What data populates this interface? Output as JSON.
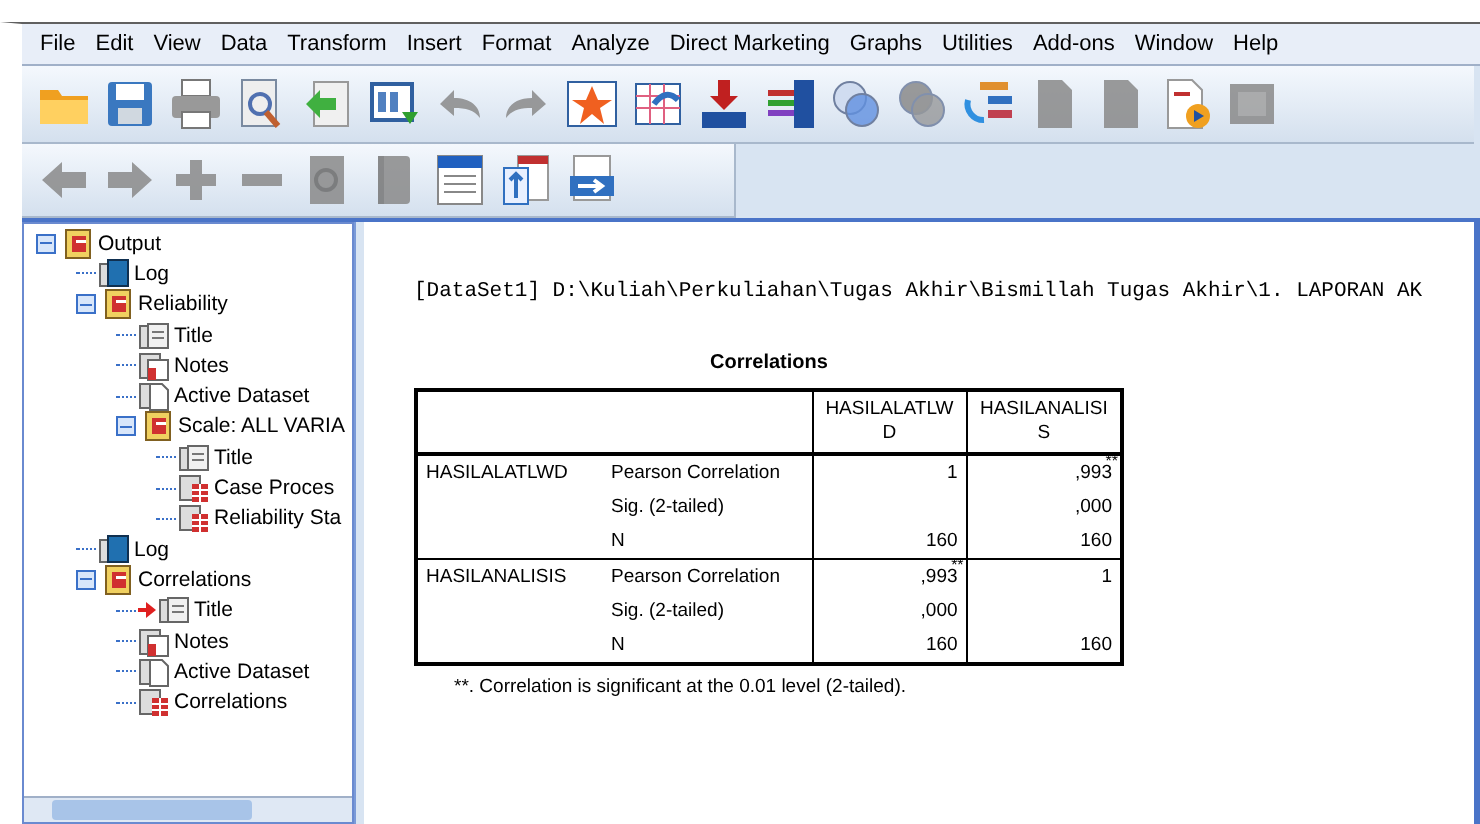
{
  "menu": [
    "File",
    "Edit",
    "View",
    "Data",
    "Transform",
    "Insert",
    "Format",
    "Analyze",
    "Direct Marketing",
    "Graphs",
    "Utilities",
    "Add-ons",
    "Window",
    "Help"
  ],
  "toolbar_main": [
    {
      "kind": "folder",
      "disabled": false
    },
    {
      "kind": "save",
      "disabled": false
    },
    {
      "kind": "print",
      "disabled": false
    },
    {
      "kind": "preview",
      "disabled": false
    },
    {
      "kind": "recall",
      "disabled": false
    },
    {
      "kind": "export",
      "disabled": false
    },
    {
      "kind": "undo",
      "disabled": true
    },
    {
      "kind": "redo",
      "disabled": true
    },
    {
      "kind": "star",
      "disabled": false
    },
    {
      "kind": "grid",
      "disabled": false
    },
    {
      "kind": "insert",
      "disabled": false
    },
    {
      "kind": "variables",
      "disabled": false
    },
    {
      "kind": "circles",
      "disabled": false
    },
    {
      "kind": "circles",
      "disabled": true
    },
    {
      "kind": "tree",
      "disabled": false
    },
    {
      "kind": "document",
      "disabled": true
    },
    {
      "kind": "document",
      "disabled": true
    },
    {
      "kind": "play",
      "disabled": false
    },
    {
      "kind": "square",
      "disabled": true
    }
  ],
  "toolbar_outline": [
    {
      "kind": "back",
      "disabled": true
    },
    {
      "kind": "forward",
      "disabled": true
    },
    {
      "kind": "plus",
      "disabled": true
    },
    {
      "kind": "minus",
      "disabled": true
    },
    {
      "kind": "preview",
      "disabled": true
    },
    {
      "kind": "book",
      "disabled": true
    },
    {
      "kind": "list",
      "disabled": false
    },
    {
      "kind": "swap",
      "disabled": false
    },
    {
      "kind": "export",
      "disabled": false
    }
  ],
  "outline": [
    {
      "label": "Output",
      "kind": "output",
      "expanded": true,
      "current": false,
      "children": [
        {
          "label": "Log",
          "kind": "log",
          "current": false
        },
        {
          "label": "Reliability",
          "kind": "output",
          "expanded": true,
          "current": false,
          "children": [
            {
              "label": "Title",
              "kind": "title",
              "current": false
            },
            {
              "label": "Notes",
              "kind": "notes",
              "current": false
            },
            {
              "label": "Active Dataset",
              "kind": "dataset",
              "current": false
            },
            {
              "label": "Scale: ALL VARIA",
              "kind": "output",
              "expanded": true,
              "current": false,
              "children": [
                {
                  "label": "Title",
                  "kind": "title",
                  "current": false
                },
                {
                  "label": "Case Proces",
                  "kind": "table",
                  "current": false
                },
                {
                  "label": "Reliability Sta",
                  "kind": "table",
                  "current": false
                }
              ]
            }
          ]
        },
        {
          "label": "Log",
          "kind": "log",
          "current": false
        },
        {
          "label": "Correlations",
          "kind": "output",
          "expanded": true,
          "current": false,
          "children": [
            {
              "label": "Title",
              "kind": "title",
              "current": true
            },
            {
              "label": "Notes",
              "kind": "notes",
              "current": false
            },
            {
              "label": "Active Dataset",
              "kind": "dataset",
              "current": false
            },
            {
              "label": "Correlations",
              "kind": "table",
              "current": false
            }
          ]
        }
      ]
    }
  ],
  "output": {
    "dataset_line": "[DataSet1] D:\\Kuliah\\Perkuliahan\\Tugas Akhir\\Bismillah Tugas Akhir\\1. LAPORAN AK",
    "table": {
      "title": "Correlations",
      "columns": [
        "HASILALATLWD",
        "HASILANALISIS"
      ],
      "groups": [
        {
          "variable": "HASILALATLWD",
          "rows": [
            {
              "statistic": "Pearson Correlation",
              "cells": [
                {
                  "text": "1"
                },
                {
                  "text": ",993",
                  "note": "**"
                }
              ]
            },
            {
              "statistic": "Sig. (2-tailed)",
              "cells": [
                {
                  "text": ""
                },
                {
                  "text": ",000"
                }
              ]
            },
            {
              "statistic": "N",
              "cells": [
                {
                  "text": "160"
                },
                {
                  "text": "160"
                }
              ]
            }
          ]
        },
        {
          "variable": "HASILANALISIS",
          "rows": [
            {
              "statistic": "Pearson Correlation",
              "cells": [
                {
                  "text": ",993",
                  "note": "**"
                },
                {
                  "text": "1"
                }
              ]
            },
            {
              "statistic": "Sig. (2-tailed)",
              "cells": [
                {
                  "text": ",000"
                },
                {
                  "text": ""
                }
              ]
            },
            {
              "statistic": "N",
              "cells": [
                {
                  "text": "160"
                },
                {
                  "text": "160"
                }
              ]
            }
          ]
        }
      ],
      "footnote": "**. Correlation is significant at the 0.01 level (2-tailed)."
    }
  }
}
